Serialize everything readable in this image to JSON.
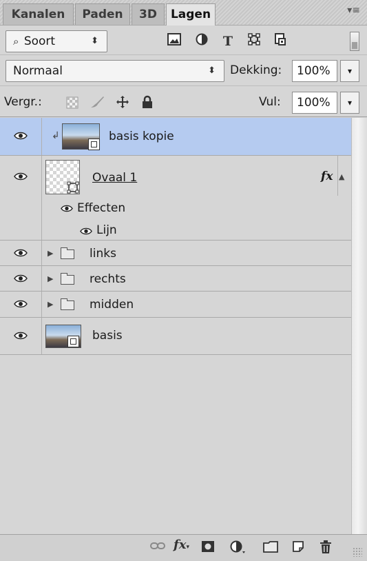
{
  "tabs": [
    {
      "label": "Kanalen",
      "active": false
    },
    {
      "label": "Paden",
      "active": false
    },
    {
      "label": "3D",
      "active": false
    },
    {
      "label": "Lagen",
      "active": true
    }
  ],
  "panel_menu_icon": "panel-menu-icon",
  "filter": {
    "kind_label": "Soort",
    "search_icon": "search-icon",
    "icons": [
      "pixel-filter-icon",
      "adjustment-filter-icon",
      "type-filter-icon",
      "shape-filter-icon",
      "smart-object-filter-icon"
    ]
  },
  "blend": {
    "mode": "Normaal",
    "opacity_label": "Dekking:",
    "opacity_value": "100%"
  },
  "lock": {
    "label": "Vergr.:",
    "icons": [
      "lock-transparent-icon",
      "lock-image-icon",
      "lock-position-icon",
      "lock-all-icon"
    ],
    "fill_label": "Vul:",
    "fill_value": "100%"
  },
  "layers": [
    {
      "name": "basis kopie",
      "type": "smart-object",
      "selected": true,
      "clipped": true
    },
    {
      "name": "Ovaal 1",
      "type": "shape",
      "selected": false,
      "has_fx": true,
      "fx_label": "fx",
      "effects_label": "Effecten",
      "effect_items": [
        "Lijn"
      ]
    },
    {
      "name": "links",
      "type": "group"
    },
    {
      "name": "rechts",
      "type": "group"
    },
    {
      "name": "midden",
      "type": "group"
    },
    {
      "name": "basis",
      "type": "smart-object"
    }
  ],
  "footer_icons": [
    "link-layers-icon",
    "fx-icon",
    "mask-icon",
    "adjustment-layer-icon",
    "new-group-icon",
    "new-layer-icon",
    "trash-icon"
  ],
  "colors": {
    "selected_row": "#b5cbf0",
    "panel_bg": "#d6d6d6"
  }
}
